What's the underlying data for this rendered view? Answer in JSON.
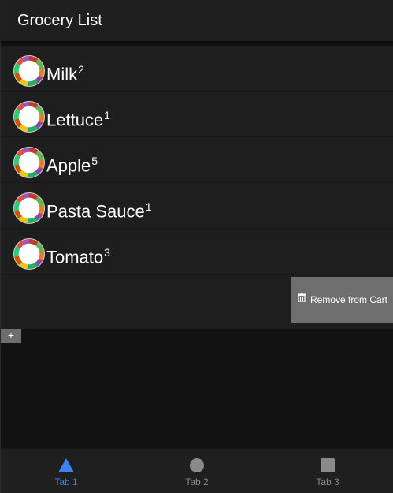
{
  "header": {
    "title": "Grocery List"
  },
  "items": [
    {
      "name": "Milk",
      "qty": "2",
      "avatar_icon": "vegetable-wreath-icon"
    },
    {
      "name": "Lettuce",
      "qty": "1",
      "avatar_icon": "vegetable-wreath-icon"
    },
    {
      "name": "Apple",
      "qty": "5",
      "avatar_icon": "vegetable-wreath-icon"
    },
    {
      "name": "Pasta Sauce",
      "qty": "1",
      "avatar_icon": "vegetable-wreath-icon"
    },
    {
      "name": "Tomato",
      "qty": "3",
      "avatar_icon": "vegetable-wreath-icon"
    }
  ],
  "swipe_action": {
    "label": "Remove from Cart",
    "icon": "trash-icon"
  },
  "add_button": {
    "label": "+"
  },
  "tabs": [
    {
      "label": "Tab 1",
      "icon": "triangle-icon",
      "active": true
    },
    {
      "label": "Tab 2",
      "icon": "circle-icon",
      "active": false
    },
    {
      "label": "Tab 3",
      "icon": "square-icon",
      "active": false
    }
  ],
  "colors": {
    "background": "#121212",
    "surface": "#1e1e1e",
    "header": "#1f1f1f",
    "swipe_button": "#6e6e6e",
    "tab_active": "#3b82f6",
    "tab_inactive": "#8a8a8a"
  }
}
